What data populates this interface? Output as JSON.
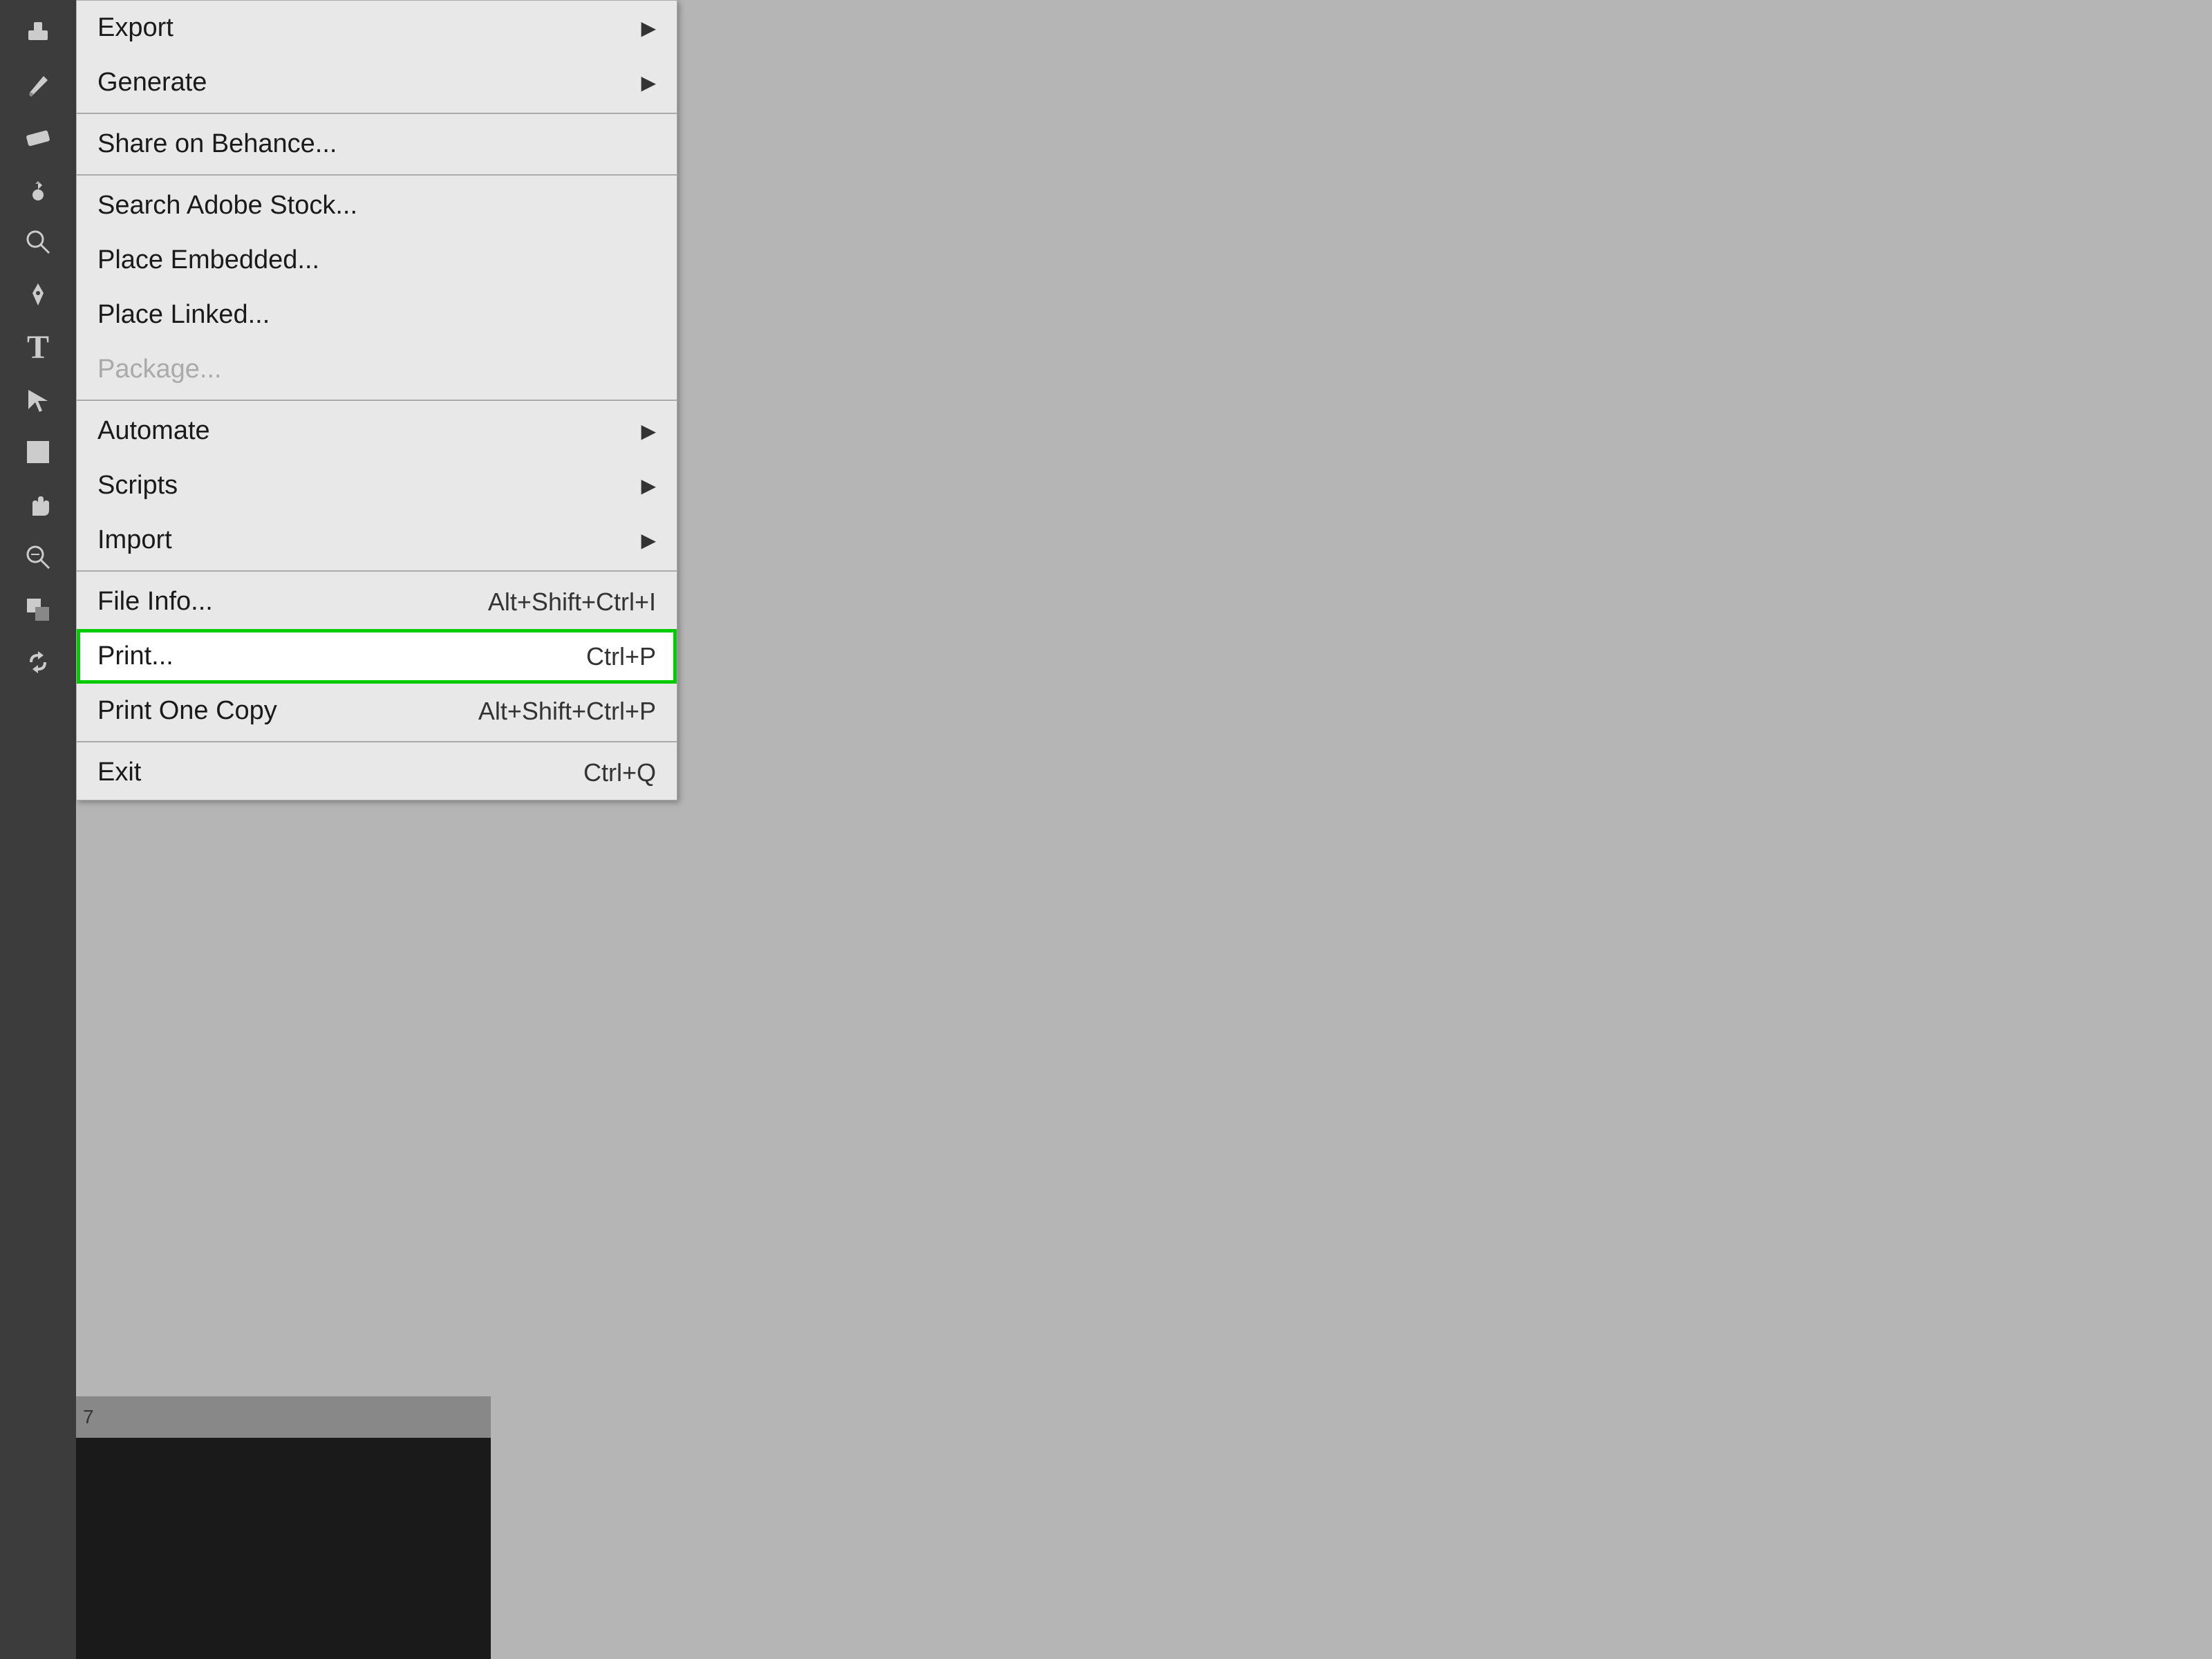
{
  "toolbar": {
    "tools": [
      {
        "name": "stamp",
        "icon": "⬛"
      },
      {
        "name": "brush",
        "icon": "✏️"
      },
      {
        "name": "eraser",
        "icon": "▭"
      },
      {
        "name": "dropper",
        "icon": "💧"
      },
      {
        "name": "zoom",
        "icon": "🔍"
      },
      {
        "name": "pen",
        "icon": "✒️"
      },
      {
        "name": "text",
        "icon": "T"
      },
      {
        "name": "select",
        "icon": "↖"
      },
      {
        "name": "rectangle",
        "icon": "□"
      },
      {
        "name": "hand",
        "icon": "✋"
      },
      {
        "name": "zoom2",
        "icon": "🔍"
      },
      {
        "name": "layer",
        "icon": "⬛"
      },
      {
        "name": "rotate",
        "icon": "↩"
      }
    ]
  },
  "menu": {
    "items": [
      {
        "label": "Export",
        "shortcut": "",
        "has_arrow": true,
        "disabled": false,
        "separator_after": false
      },
      {
        "label": "Generate",
        "shortcut": "",
        "has_arrow": true,
        "disabled": false,
        "separator_after": true
      },
      {
        "label": "Share on Behance...",
        "shortcut": "",
        "has_arrow": false,
        "disabled": false,
        "separator_after": true
      },
      {
        "label": "Search Adobe Stock...",
        "shortcut": "",
        "has_arrow": false,
        "disabled": false,
        "separator_after": false
      },
      {
        "label": "Place Embedded...",
        "shortcut": "",
        "has_arrow": false,
        "disabled": false,
        "separator_after": false
      },
      {
        "label": "Place Linked...",
        "shortcut": "",
        "has_arrow": false,
        "disabled": false,
        "separator_after": false
      },
      {
        "label": "Package...",
        "shortcut": "",
        "has_arrow": false,
        "disabled": true,
        "separator_after": true
      },
      {
        "label": "Automate",
        "shortcut": "",
        "has_arrow": true,
        "disabled": false,
        "separator_after": false
      },
      {
        "label": "Scripts",
        "shortcut": "",
        "has_arrow": true,
        "disabled": false,
        "separator_after": false
      },
      {
        "label": "Import",
        "shortcut": "",
        "has_arrow": true,
        "disabled": false,
        "separator_after": true
      },
      {
        "label": "File Info...",
        "shortcut": "Alt+Shift+Ctrl+I",
        "has_arrow": false,
        "disabled": false,
        "separator_after": false
      },
      {
        "label": "Print...",
        "shortcut": "Ctrl+P",
        "has_arrow": false,
        "disabled": false,
        "highlighted": true,
        "separator_after": false
      },
      {
        "label": "Print One Copy",
        "shortcut": "Alt+Shift+Ctrl+P",
        "has_arrow": false,
        "disabled": false,
        "separator_after": true
      },
      {
        "label": "Exit",
        "shortcut": "Ctrl+Q",
        "has_arrow": false,
        "disabled": false,
        "separator_after": false
      }
    ]
  },
  "canvas": {
    "ruler_number": "7"
  }
}
